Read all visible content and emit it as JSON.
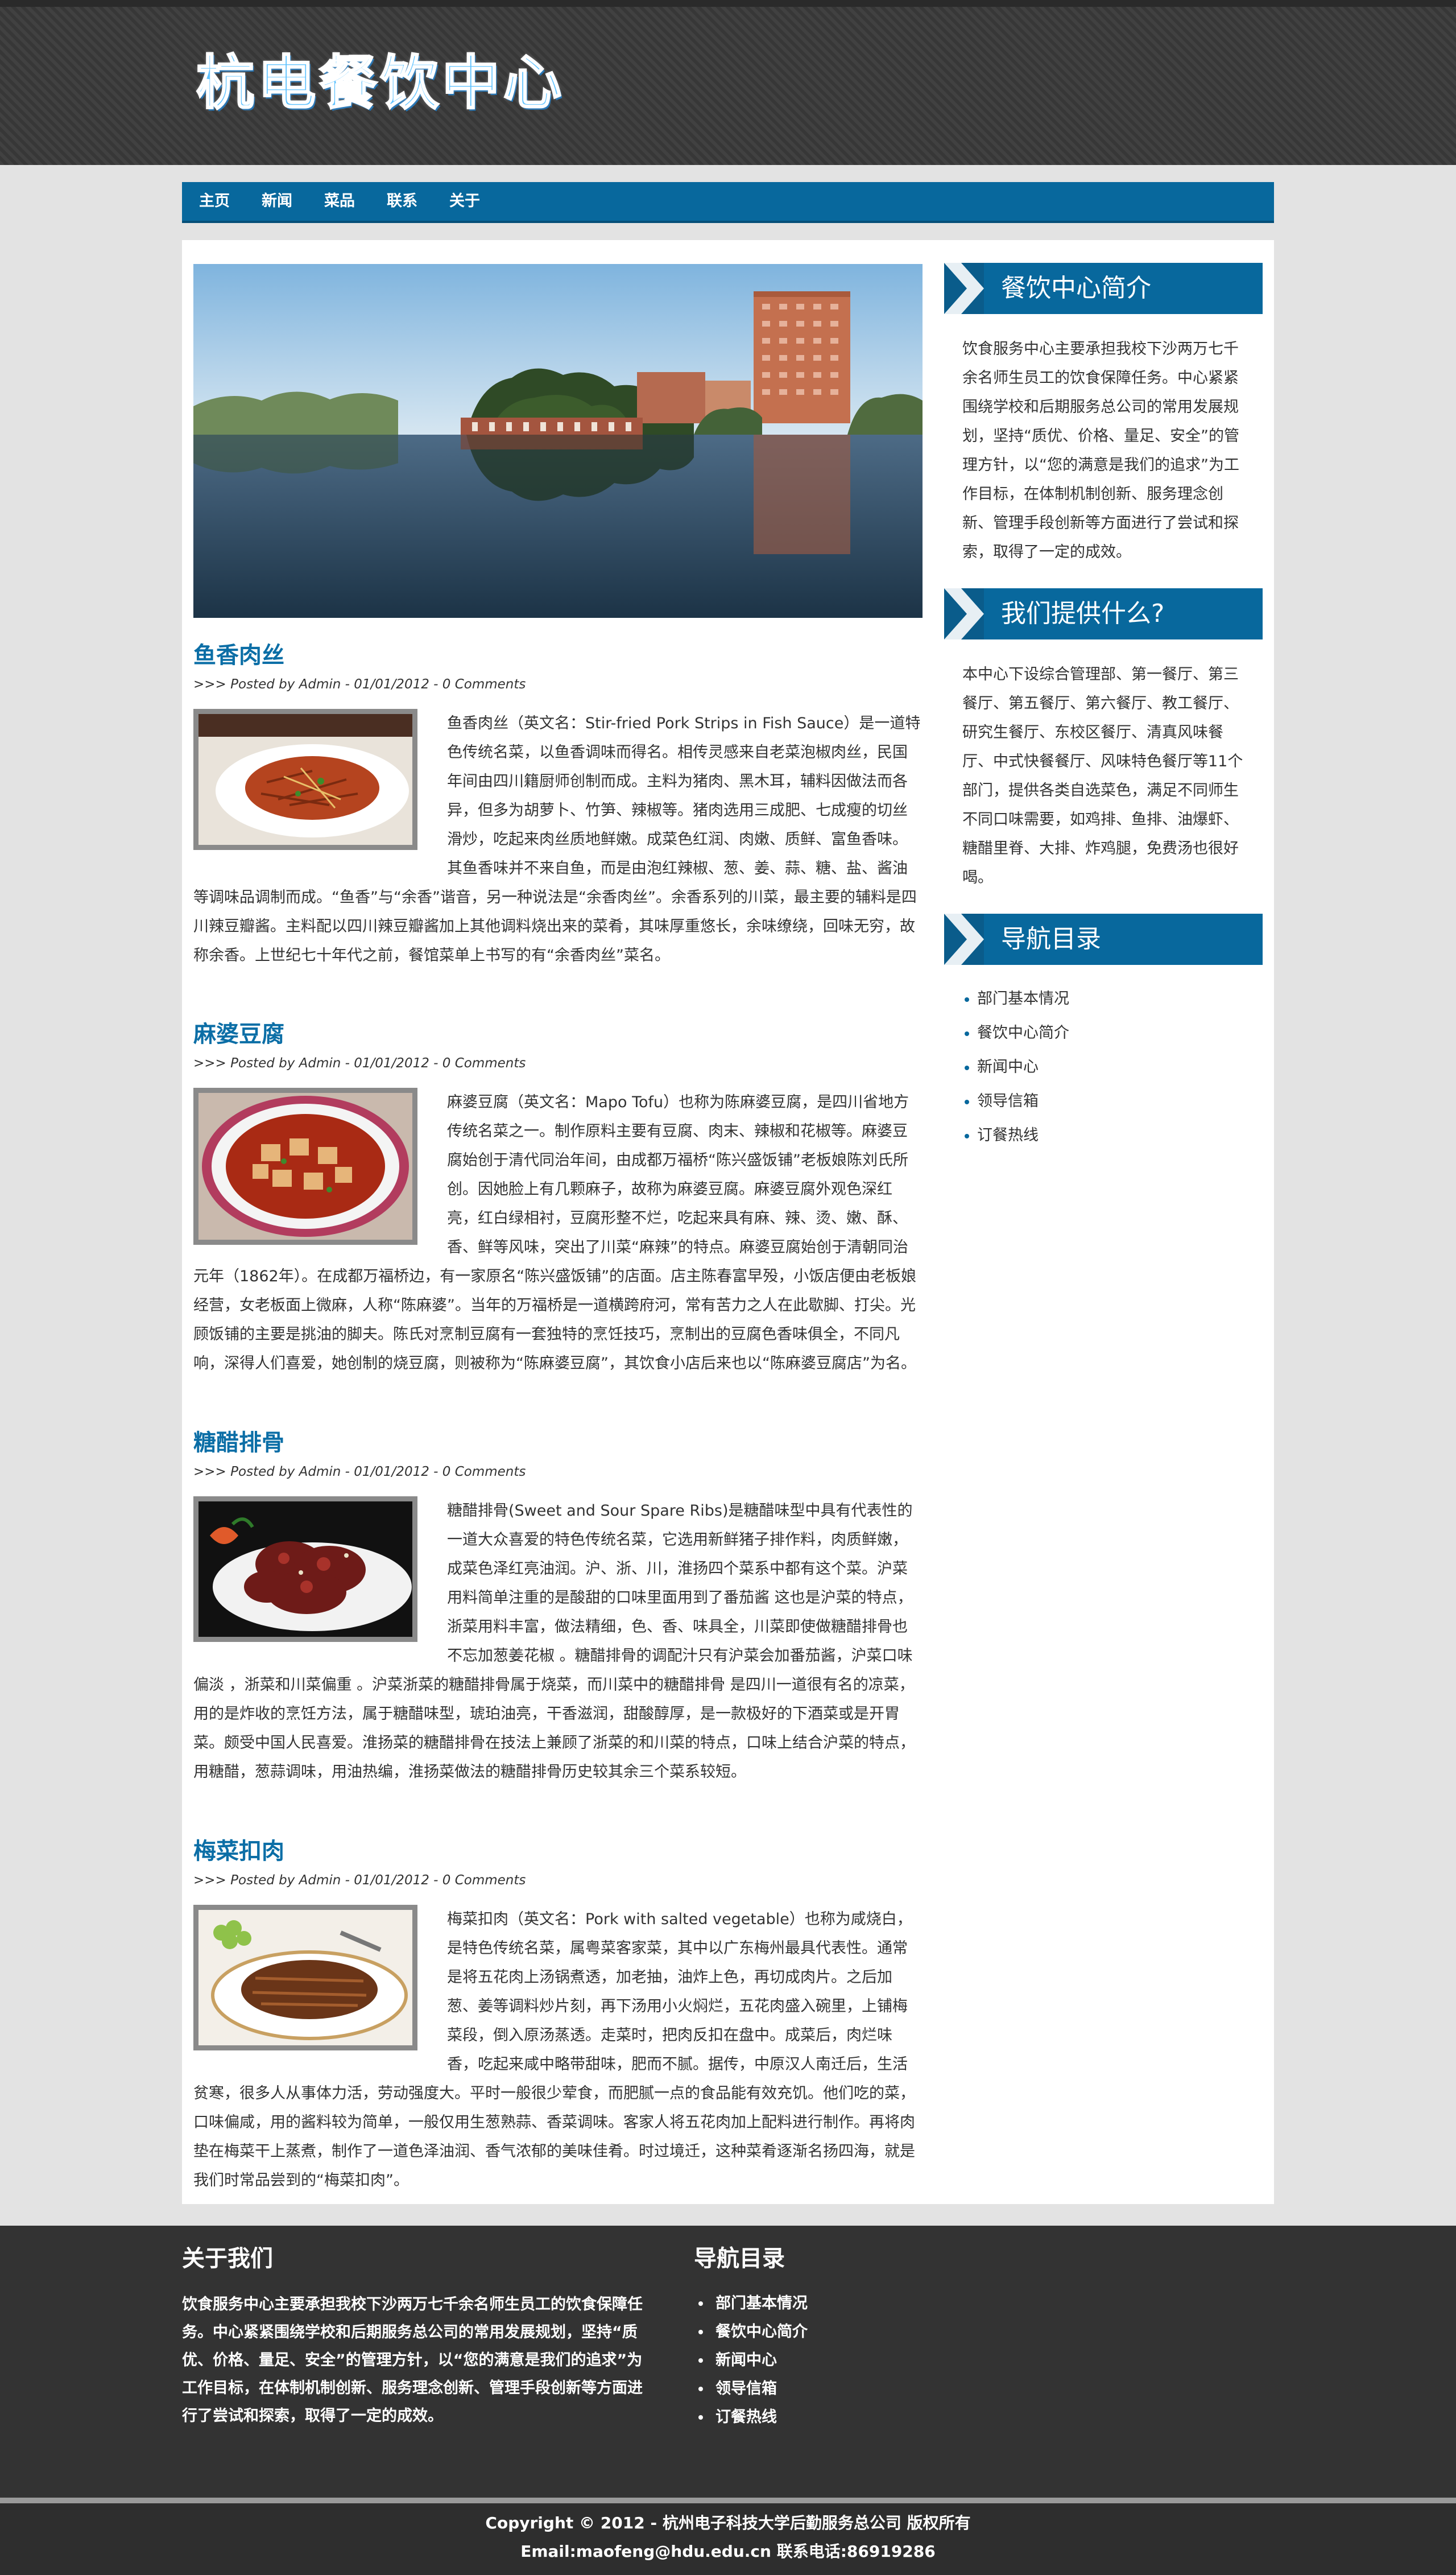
{
  "site": {
    "logo": "杭电餐饮中心"
  },
  "nav": {
    "items": [
      "主页",
      "新闻",
      "菜品",
      "联系",
      "关于"
    ]
  },
  "posts": [
    {
      "title": "鱼香肉丝",
      "meta": ">>> Posted by Admin - 01/01/2012 - 0 Comments",
      "body": "鱼香肉丝（英文名：Stir-fried Pork Strips in Fish Sauce）是一道特色传统名菜，以鱼香调味而得名。相传灵感来自老菜泡椒肉丝，民国年间由四川籍厨师创制而成。主料为猪肉、黑木耳，辅料因做法而各异，但多为胡萝卜、竹笋、辣椒等。猪肉选用三成肥、七成瘦的切丝滑炒，吃起来肉丝质地鲜嫩。成菜色红润、肉嫩、质鲜、富鱼香味。其鱼香味并不来自鱼，而是由泡红辣椒、葱、姜、蒜、糖、盐、酱油等调味品调制而成。“鱼香”与“余香”谐音，另一种说法是“余香肉丝”。余香系列的川菜，最主要的辅料是四川辣豆瓣酱。主料配以四川辣豆瓣酱加上其他调料烧出来的菜肴，其味厚重悠长，余味缭绕，回味无穷，故称余香。上世纪七十年代之前，餐馆菜单上书写的有“余香肉丝”菜名。"
    },
    {
      "title": "麻婆豆腐",
      "meta": ">>> Posted by Admin - 01/01/2012 - 0 Comments",
      "body": "麻婆豆腐（英文名：Mapo Tofu）也称为陈麻婆豆腐，是四川省地方传统名菜之一。制作原料主要有豆腐、肉末、辣椒和花椒等。麻婆豆腐始创于清代同治年间，由成都万福桥“陈兴盛饭铺”老板娘陈刘氏所创。因她脸上有几颗麻子，故称为麻婆豆腐。麻婆豆腐外观色深红亮，红白绿相衬，豆腐形整不烂，吃起来具有麻、辣、烫、嫩、酥、香、鲜等风味，突出了川菜“麻辣”的特点。麻婆豆腐始创于清朝同治元年（1862年）。在成都万福桥边，有一家原名“陈兴盛饭铺”的店面。店主陈春富早殁，小饭店便由老板娘经营，女老板面上微麻，人称“陈麻婆”。当年的万福桥是一道横跨府河，常有苦力之人在此歇脚、打尖。光顾饭铺的主要是挑油的脚夫。陈氏对烹制豆腐有一套独特的烹饪技巧，烹制出的豆腐色香味俱全，不同凡响，深得人们喜爱，她创制的烧豆腐，则被称为“陈麻婆豆腐”，其饮食小店后来也以“陈麻婆豆腐店”为名。"
    },
    {
      "title": "糖醋排骨",
      "meta": ">>> Posted by Admin - 01/01/2012 - 0 Comments",
      "body": "糖醋排骨(Sweet and Sour Spare Ribs)是糖醋味型中具有代表性的一道大众喜爱的特色传统名菜，它选用新鲜猪子排作料，肉质鲜嫩，成菜色泽红亮油润。沪、浙、川，淮扬四个菜系中都有这个菜。沪菜用料简单注重的是酸甜的口味里面用到了番茄酱 这也是沪菜的特点，浙菜用料丰富，做法精细，色、香、味具全，川菜即使做糖醋排骨也不忘加葱姜花椒 。糖醋排骨的调配汁只有沪菜会加番茄酱，沪菜口味偏淡 ，浙菜和川菜偏重 。沪菜浙菜的糖醋排骨属于烧菜，而川菜中的糖醋排骨 是四川一道很有名的凉菜，用的是炸收的烹饪方法，属于糖醋味型，琥珀油亮，干香滋润，甜酸醇厚，是一款极好的下酒菜或是开胃菜。颇受中国人民喜爱。淮扬菜的糖醋排骨在技法上兼顾了浙菜的和川菜的特点，口味上结合沪菜的特点，用糖醋，葱蒜调味，用油热编，淮扬菜做法的糖醋排骨历史较其余三个菜系较短。"
    },
    {
      "title": "梅菜扣肉",
      "meta": ">>> Posted by Admin - 01/01/2012 - 0 Comments",
      "body": "梅菜扣肉（英文名：Pork with salted vegetable）也称为咸烧白，是特色传统名菜，属粤菜客家菜，其中以广东梅州最具代表性。通常是将五花肉上汤锅煮透，加老抽，油炸上色，再切成肉片。之后加葱、姜等调料炒片刻，再下汤用小火焖烂，五花肉盛入碗里，上铺梅菜段，倒入原汤蒸透。走菜时，把肉反扣在盘中。成菜后，肉烂味香，吃起来咸中略带甜味，肥而不腻。据传，中原汉人南迁后，生活贫寒，很多人从事体力活，劳动强度大。平时一般很少荤食，而肥腻一点的食品能有效充饥。他们吃的菜，口味偏咸，用的酱料较为简单，一般仅用生葱熟蒜、香菜调味。客家人将五花肉加上配料进行制作。再将肉垫在梅菜干上蒸煮，制作了一道色泽油润、香气浓郁的美味佳肴。时过境迁，这种菜肴逐渐名扬四海，就是我们时常品尝到的“梅菜扣肉”。"
    }
  ],
  "sidebar": {
    "intro_title": "餐饮中心简介",
    "intro_text": "饮食服务中心主要承担我校下沙两万七千余名师生员工的饮食保障任务。中心紧紧围绕学校和后期服务总公司的常用发展规划，坚持“质优、价格、量足、安全”的管理方针，以“您的满意是我们的追求”为工作目标，在体制机制创新、服务理念创新、管理手段创新等方面进行了尝试和探索，取得了一定的成效。",
    "offer_title": "我们提供什么?",
    "offer_text": "本中心下设综合管理部、第一餐厅、第三餐厅、第五餐厅、第六餐厅、教工餐厅、研究生餐厅、东校区餐厅、清真风味餐厅、中式快餐餐厅、风味特色餐厅等11个部门，提供各类自选菜色，满足不同师生不同口味需要，如鸡排、鱼排、油爆虾、糖醋里脊、大排、炸鸡腿，免费汤也很好喝。",
    "nav_title": "导航目录",
    "nav_items": [
      "部门基本情况",
      "餐饮中心简介",
      "新闻中心",
      "领导信箱",
      "订餐热线"
    ]
  },
  "footer": {
    "about_title": "关于我们",
    "about_text": "饮食服务中心主要承担我校下沙两万七千余名师生员工的饮食保障任务。中心紧紧围绕学校和后期服务总公司的常用发展规划，坚持“质优、价格、量足、安全”的管理方针，以“您的满意是我们的追求”为工作目标，在体制机制创新、服务理念创新、管理手段创新等方面进行了尝试和探索，取得了一定的成效。",
    "nav_title": "导航目录",
    "nav_items": [
      "部门基本情况",
      "餐饮中心简介",
      "新闻中心",
      "领导信箱",
      "订餐热线"
    ],
    "copyright": "Copyright © 2012 - 杭州电子科技大学后勤服务总公司 版权所有",
    "contact": "Email:maofeng@hdu.edu.cn 联系电话:86919286"
  },
  "colors": {
    "brand_blue": "#08689d",
    "title_blue": "#0b6ea6",
    "header_dark": "#3a3a3a",
    "footer_dark": "#333333"
  }
}
